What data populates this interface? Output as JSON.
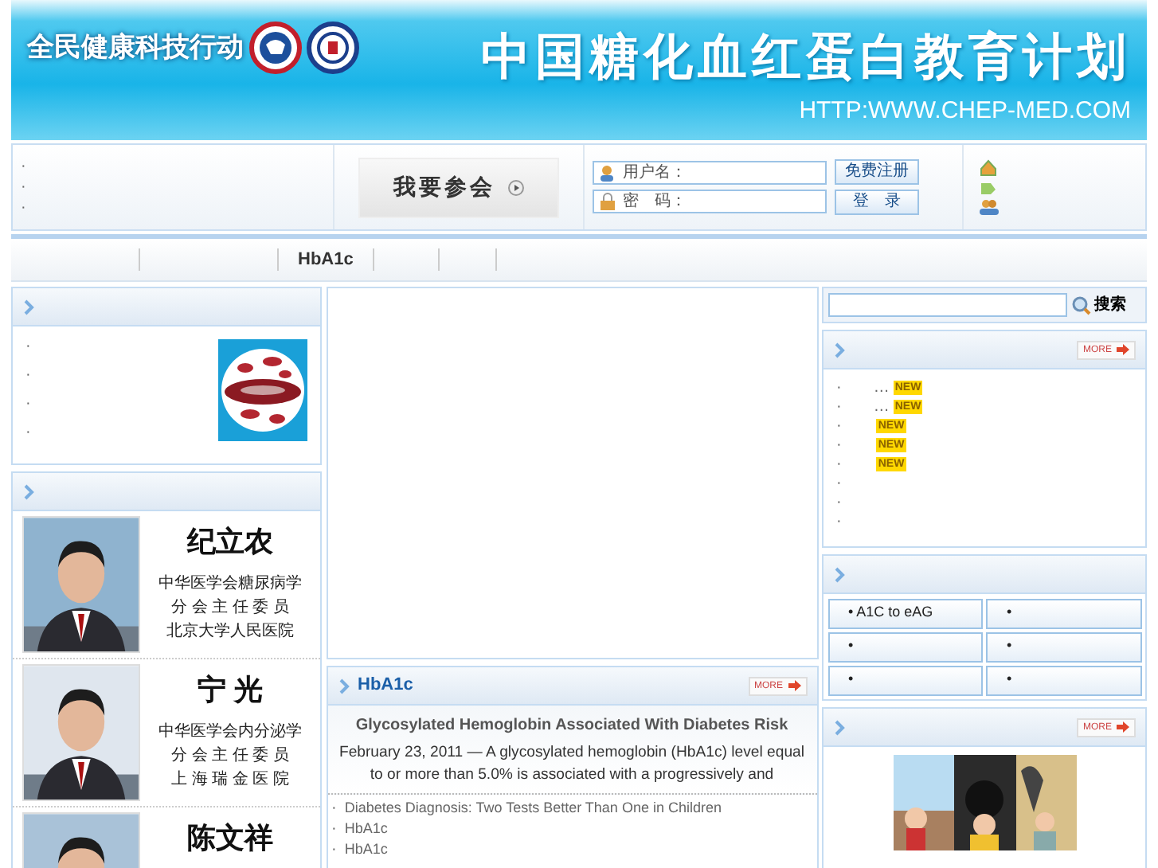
{
  "banner": {
    "slogan": "全民健康科技行动",
    "title": "中国糖化血红蛋白教育计划",
    "url": "HTTP:WWW.CHEP-MED.COM"
  },
  "top_links": [
    "·",
    "·",
    "·"
  ],
  "join_button": "我要参会",
  "login": {
    "username_label": "用户名：",
    "password_label": "密　码：",
    "register_button": "免费注册",
    "login_button": "登　录"
  },
  "nav": {
    "items": [
      "HbA1c"
    ]
  },
  "intro_panel": {
    "links": [
      "·",
      "·",
      "·",
      "·"
    ]
  },
  "experts": [
    {
      "name": "纪立农",
      "lines": [
        "中华医学会糖尿病学",
        "分 会 主 任 委 员",
        "北京大学人民医院"
      ]
    },
    {
      "name": "宁 光",
      "lines": [
        "中华医学会内分泌学",
        "分 会 主 任 委 员",
        "上 海 瑞 金 医 院"
      ]
    },
    {
      "name": "陈文祥"
    }
  ],
  "hba1c_panel": {
    "title": "HbA1c",
    "more": "MORE",
    "featured_title": "Glycosylated Hemoglobin Associated With Diabetes Risk",
    "summary": "February 23, 2011 — A glycosylated hemoglobin (HbA1c) level equal to or more than 5.0% is associated with a progressively and",
    "links": [
      {
        "bullet": "·",
        "text": "Diabetes Diagnosis: Two Tests Better Than One in Children"
      },
      {
        "bullet": "·",
        "text": "HbA1c"
      },
      {
        "bullet": "·",
        "text": "HbA1c"
      }
    ]
  },
  "search": {
    "button": "搜索"
  },
  "news_panel": {
    "more": "MORE",
    "items": [
      {
        "bullet": "·",
        "text": "…",
        "badge": "NEW"
      },
      {
        "bullet": "·",
        "text": "…",
        "badge": "NEW"
      },
      {
        "bullet": "·",
        "badge": "NEW"
      },
      {
        "bullet": "·",
        "badge": "NEW"
      },
      {
        "bullet": "·",
        "badge": "NEW"
      },
      {
        "bullet": "·"
      },
      {
        "bullet": "·"
      },
      {
        "bullet": "·"
      }
    ]
  },
  "tools": [
    "• A1C to eAG",
    "•",
    "•",
    "•",
    "•",
    "•"
  ],
  "video_panel": {
    "more": "MORE"
  }
}
